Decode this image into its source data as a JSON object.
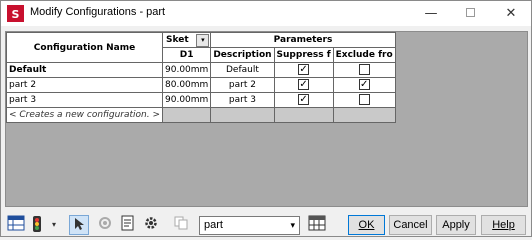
{
  "window": {
    "title": "Modify Configurations - part",
    "minimize_glyph": "—",
    "close_glyph": "✕"
  },
  "table": {
    "header": {
      "configuration_name": "Configuration Name",
      "sketch_label": "Sket",
      "parameters": "Parameters",
      "d1": "D1",
      "description": "Description",
      "suppress": "Suppress f",
      "exclude": "Exclude fro"
    },
    "rows": [
      {
        "name": "Default",
        "d1": "90.00mm",
        "description": "Default",
        "suppress": true,
        "exclude": false
      },
      {
        "name": "part 2",
        "d1": "80.00mm",
        "description": "part 2",
        "suppress": true,
        "exclude": true
      },
      {
        "name": "part 3",
        "d1": "90.00mm",
        "description": "part 3",
        "suppress": true,
        "exclude": false
      }
    ],
    "new_row_label": "< Creates a new configuration. >"
  },
  "toolbar": {
    "config_select_value": "part",
    "ok_label": "OK",
    "cancel_label": "Cancel",
    "apply_label": "Apply",
    "help_label": "Help"
  },
  "colors": {
    "grid_background": "#aaaaaa",
    "accent": "#0078d7"
  }
}
